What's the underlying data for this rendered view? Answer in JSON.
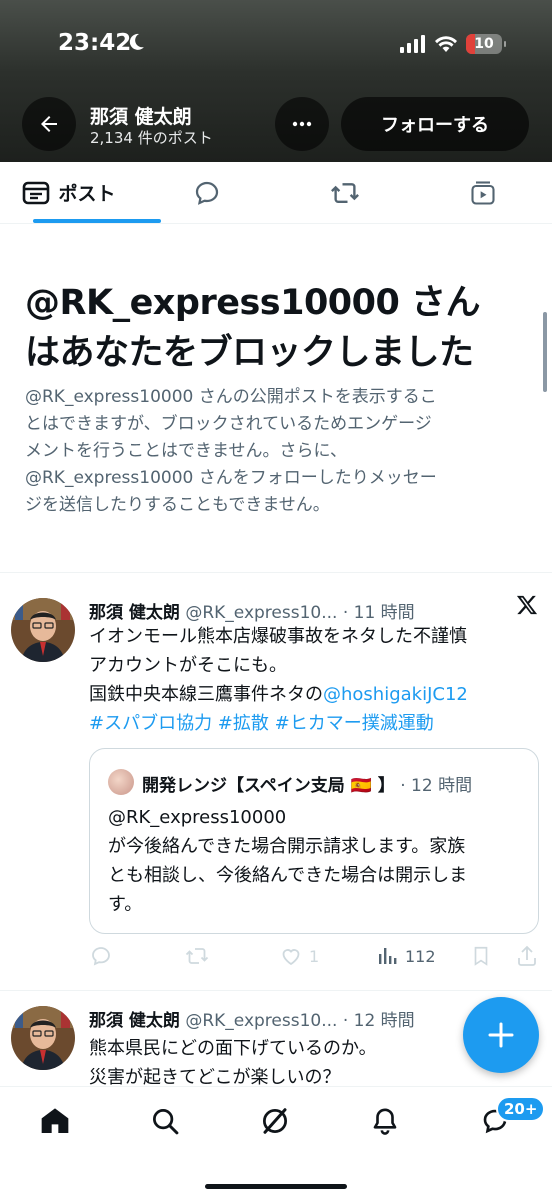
{
  "status_bar": {
    "time": "23:42",
    "battery": "10"
  },
  "header": {
    "name": "那須 健太朗",
    "post_count": "2,134 件のポスト",
    "follow_label": "フォローする"
  },
  "tabs": [
    {
      "label": "ポスト",
      "icon": "posts-icon",
      "active": true
    },
    {
      "label": "",
      "icon": "replies-icon"
    },
    {
      "label": "",
      "icon": "reposts-icon"
    },
    {
      "label": "",
      "icon": "media-icon"
    }
  ],
  "blocked": {
    "title_line1": "@RK_express10000 さん",
    "title_line2": "はあなたをブロックしました",
    "desc_lines": [
      "@RK_express10000 さんの公開ポストを表示するこ",
      "とはできますが、ブロックされているためエンゲージ",
      "メントを行うことはできません。さらに、",
      "@RK_express10000 さんをフォローしたりメッセー",
      "ジを送信したりすることもできません。"
    ]
  },
  "tweets": [
    {
      "name": "那須 健太朗",
      "handle_time": "@RK_express10... · 11 時間",
      "line1": "イオンモール熊本店爆破事故をネタした不謹慎",
      "line2": "アカウントがそこにも。",
      "line3_text": "国鉄中央本線三鷹事件ネタの",
      "line3_link": "@hoshigakiJC12",
      "hashtags": "#スパブロ協力 #拡散 #ヒカマー撲滅運動",
      "quote": {
        "name": "開発レンジ【スペイン支局 🇪🇸 】",
        "time": "· 12 時間",
        "lines": [
          "@RK_express10000",
          "が今後絡んできた場合開示請求します。家族",
          "とも相談し、今後絡んできた場合は開示しま",
          "す。"
        ]
      },
      "likes": "1",
      "views": "112"
    },
    {
      "name": "那須 健太朗",
      "handle_time": "@RK_express10... · 12 時間",
      "line1": "熊本県民にどの面下げているのか。",
      "line2": "災害が起きてどこが楽しいの？"
    }
  ],
  "nav": {
    "badge": "20+"
  },
  "colors": {
    "accent": "#1d9bf0",
    "text": "#0f1419",
    "secondary": "#536471"
  }
}
